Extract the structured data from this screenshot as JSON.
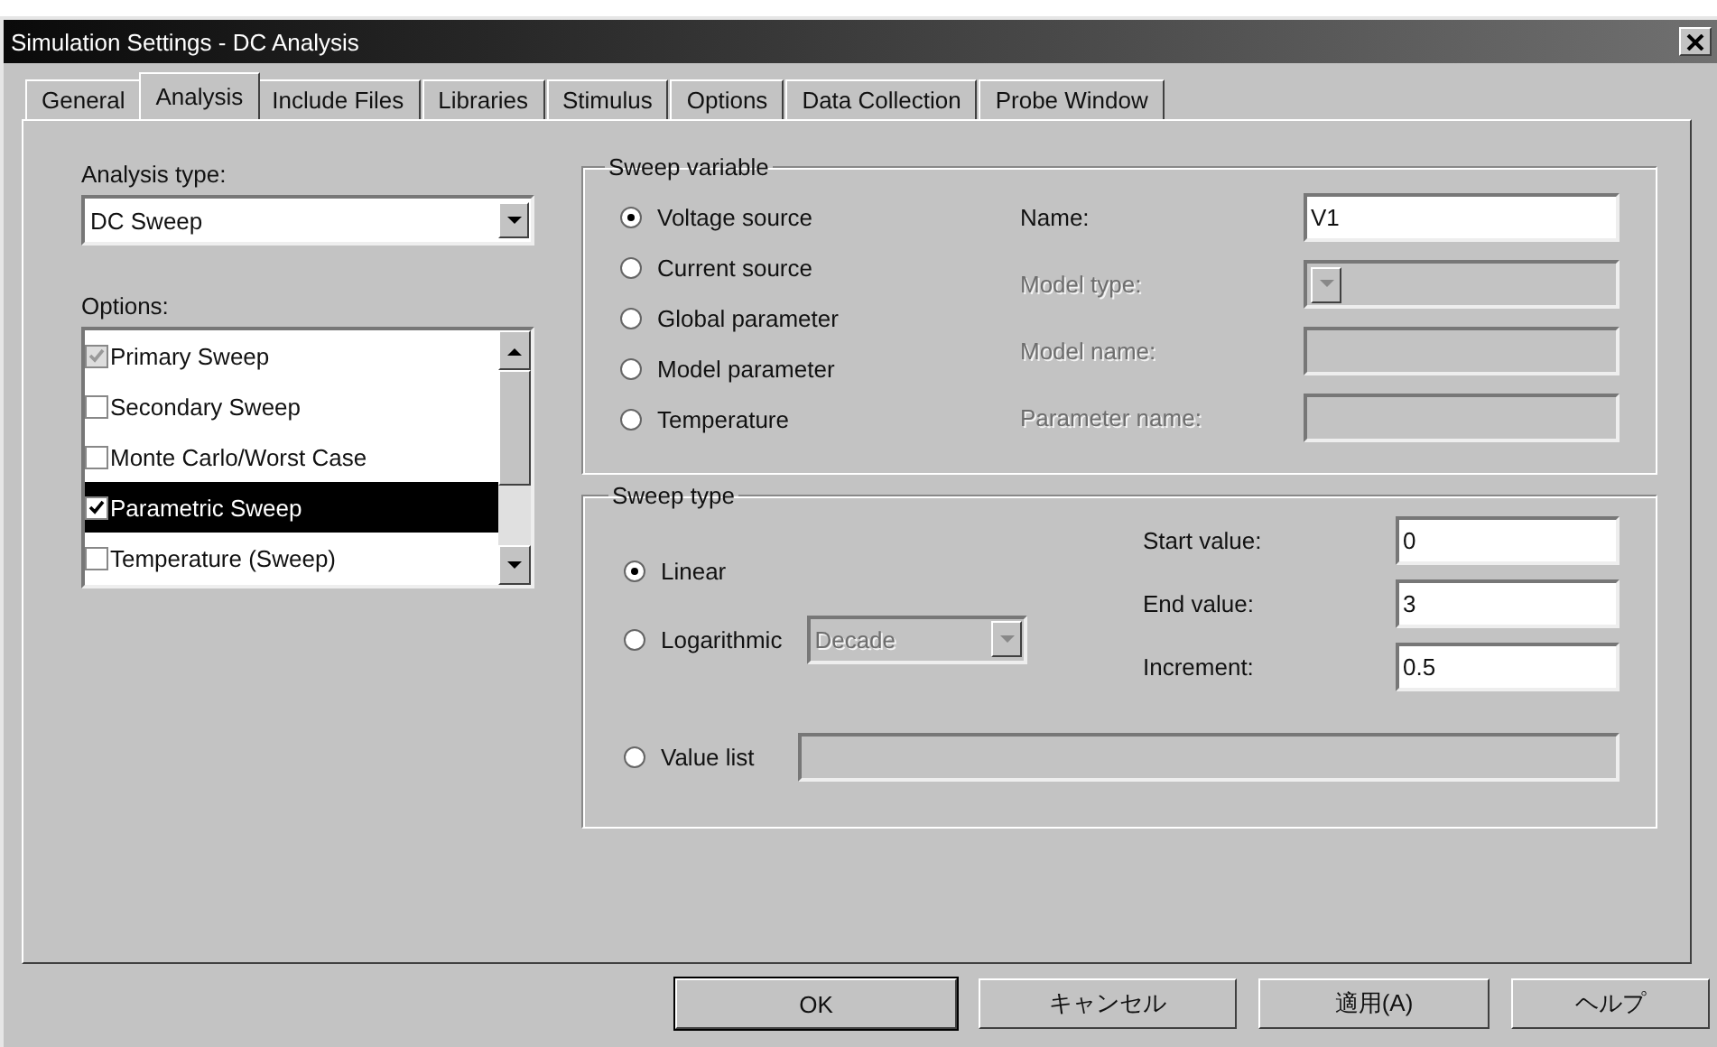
{
  "window": {
    "title": "Simulation Settings - DC Analysis"
  },
  "tabs": [
    {
      "label": "General",
      "selected": false
    },
    {
      "label": "Analysis",
      "selected": true
    },
    {
      "label": "Include Files",
      "selected": false
    },
    {
      "label": "Libraries",
      "selected": false
    },
    {
      "label": "Stimulus",
      "selected": false
    },
    {
      "label": "Options",
      "selected": false
    },
    {
      "label": "Data Collection",
      "selected": false
    },
    {
      "label": "Probe Window",
      "selected": false
    }
  ],
  "analysis_type": {
    "label": "Analysis type:",
    "value": "DC Sweep"
  },
  "options": {
    "label": "Options:",
    "items": [
      {
        "label": "Primary Sweep",
        "checked": true,
        "disabled": true,
        "selected": false
      },
      {
        "label": "Secondary Sweep",
        "checked": false,
        "disabled": false,
        "selected": false
      },
      {
        "label": "Monte Carlo/Worst Case",
        "checked": false,
        "disabled": false,
        "selected": false
      },
      {
        "label": "Parametric Sweep",
        "checked": true,
        "disabled": false,
        "selected": true
      },
      {
        "label": "Temperature (Sweep)",
        "checked": false,
        "disabled": false,
        "selected": false
      }
    ]
  },
  "sweep_variable": {
    "title": "Sweep variable",
    "sources": [
      {
        "label": "Voltage source",
        "selected": true
      },
      {
        "label": "Current source",
        "selected": false
      },
      {
        "label": "Global parameter",
        "selected": false
      },
      {
        "label": "Model parameter",
        "selected": false
      },
      {
        "label": "Temperature",
        "selected": false
      }
    ],
    "fields": [
      {
        "label": "Name:",
        "kind": "text",
        "value": "V1",
        "disabled": false
      },
      {
        "label": "Model type:",
        "kind": "dropdown",
        "disabled": true
      },
      {
        "label": "Model name:",
        "kind": "text",
        "disabled": true
      },
      {
        "label": "Parameter name:",
        "kind": "text",
        "disabled": true
      }
    ]
  },
  "sweep_type": {
    "title": "Sweep type",
    "types": [
      {
        "label": "Linear",
        "selected": true
      },
      {
        "label": "Logarithmic",
        "selected": false
      },
      {
        "label": "Value list",
        "selected": false
      }
    ],
    "log_scale": {
      "value": "Decade",
      "disabled": true
    },
    "value_list": {
      "disabled": true
    },
    "fields": [
      {
        "label": "Start value:",
        "value": "0"
      },
      {
        "label": "End value:",
        "value": "3"
      },
      {
        "label": "Increment:",
        "value": "0.5"
      }
    ]
  },
  "buttons": [
    {
      "label": "OK",
      "default": true
    },
    {
      "label": "キャンセル",
      "default": false
    },
    {
      "label": "適用(A)",
      "default": false
    },
    {
      "label": "ヘルプ",
      "default": false
    }
  ]
}
